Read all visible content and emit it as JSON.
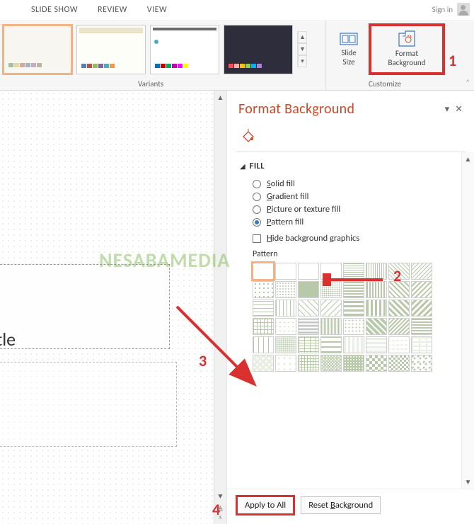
{
  "ribbon": {
    "tabs": [
      "SLIDE SHOW",
      "REVIEW",
      "VIEW"
    ],
    "sign_in": "Sign in",
    "groups": {
      "variants": "Variants",
      "customize": "Customize"
    },
    "slide_size": {
      "line1": "Slide",
      "line2": "Size"
    },
    "format_bg": {
      "line1": "Format",
      "line2": "Background"
    }
  },
  "pane": {
    "title": "Format Background",
    "section_fill": "FILL",
    "options": {
      "solid": "Solid fill",
      "gradient": "Gradient fill",
      "picture": "Picture or texture fill",
      "pattern": "Pattern fill"
    },
    "hide_bg": "Hide background graphics",
    "pattern_label": "Pattern",
    "apply_all": "Apply to All",
    "reset": "Reset Background"
  },
  "slide": {
    "title_placeholder": "title"
  },
  "annotations": {
    "n1": "1",
    "n2": "2",
    "n3": "3",
    "n4": "4"
  },
  "watermark": "NESABAMEDIA"
}
